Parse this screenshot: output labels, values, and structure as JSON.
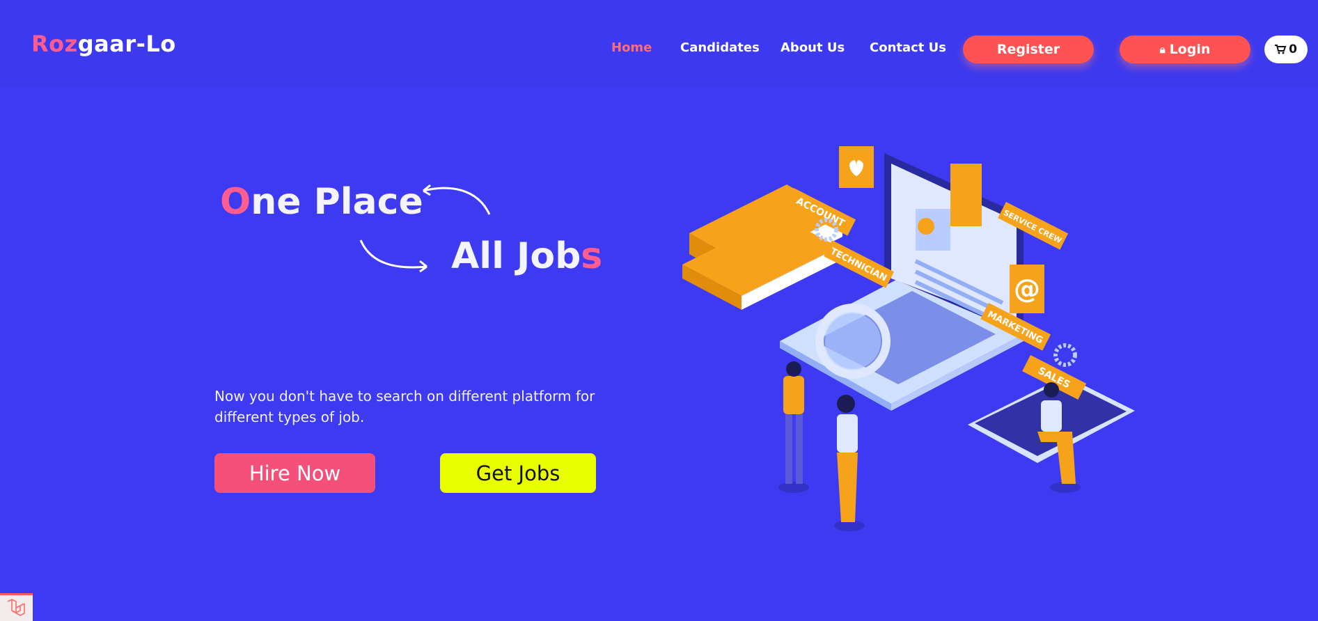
{
  "header": {
    "logo_part1": "Roz",
    "logo_part2": "gaar-Lo",
    "nav": [
      "Home",
      "Candidates",
      "About Us",
      "Contact Us"
    ],
    "register_label": "Register",
    "login_label": "Login",
    "cart_count": "0"
  },
  "hero": {
    "line1_first": "O",
    "line1_rest": "ne Place",
    "line2_main": "All Job",
    "line2_last": "s",
    "description": "Now you don't have to search on different platform for different types of job.",
    "hire_label": "Hire Now",
    "jobs_label": "Get Jobs"
  },
  "illustration": {
    "tags": [
      "ACCOUNT",
      "TECHNICIAN",
      "SERVICE CREW",
      "MARKETING",
      "SALES"
    ],
    "at_symbol": "@"
  },
  "colors": {
    "background": "#3d3af2",
    "accent_pink": "#ff5d8f",
    "button_red": "#ff5252",
    "button_yellow": "#e9ff00",
    "illustration_orange": "#f7a21b"
  }
}
